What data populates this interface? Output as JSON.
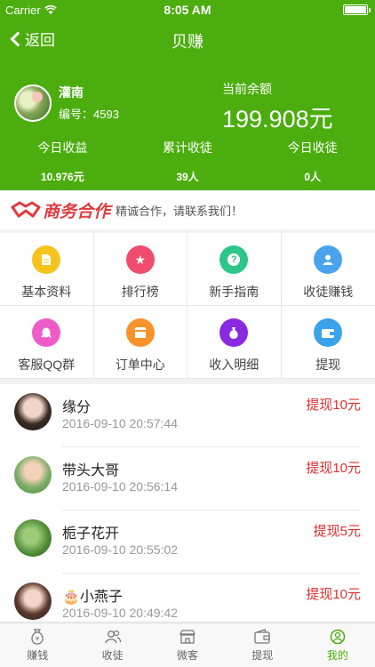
{
  "status": {
    "carrier": "Carrier",
    "time": "8:05 AM"
  },
  "nav": {
    "back_label": "返回",
    "title": "贝赚"
  },
  "profile": {
    "name": "灌南",
    "code": "编号：4593"
  },
  "balance": {
    "label": "当前余额",
    "value": "199.908元"
  },
  "stats": [
    {
      "label": "今日收益",
      "value": "10.976元"
    },
    {
      "label": "累计收徒",
      "value": "39人"
    },
    {
      "label": "今日收徒",
      "value": "0人"
    }
  ],
  "banner": {
    "logo": "商务合作",
    "subtitle": "精诚合作，请联系我们！"
  },
  "grid": [
    {
      "label": "基本资料",
      "icon": "document-icon",
      "color": "#f5c31c"
    },
    {
      "label": "排行榜",
      "icon": "star-icon",
      "color": "#ef4c6e"
    },
    {
      "label": "新手指南",
      "icon": "help-icon",
      "color": "#2dc58a"
    },
    {
      "label": "收徒赚钱",
      "icon": "user-icon",
      "color": "#4aa3ec"
    },
    {
      "label": "客服QQ群",
      "icon": "qq-icon",
      "color": "#ee5cc8"
    },
    {
      "label": "订单中心",
      "icon": "shop-icon",
      "color": "#f7932a"
    },
    {
      "label": "收入明细",
      "icon": "money-bag-icon",
      "color": "#8a2ae0"
    },
    {
      "label": "提现",
      "icon": "wallet-icon",
      "color": "#3aa2e8"
    }
  ],
  "list": [
    {
      "name": "缘分",
      "time": "2016-09-10 20:57:44",
      "amount": "提现10元"
    },
    {
      "name": "带头大哥",
      "time": "2016-09-10 20:56:14",
      "amount": "提现10元"
    },
    {
      "name": "栀子花开",
      "time": "2016-09-10 20:55:02",
      "amount": "提现5元"
    },
    {
      "name": "🎂小燕子",
      "time": "2016-09-10 20:49:42",
      "amount": "提现10元"
    }
  ],
  "tabs": [
    {
      "label": "赚钱",
      "icon": "money-bag-icon"
    },
    {
      "label": "收徒",
      "icon": "users-icon"
    },
    {
      "label": "微客",
      "icon": "shop-icon"
    },
    {
      "label": "提现",
      "icon": "wallet-icon"
    },
    {
      "label": "我的",
      "icon": "smile-icon",
      "active": true
    }
  ],
  "colors": {
    "brand": "#4cad0e",
    "accent_red": "#e12f2f"
  }
}
